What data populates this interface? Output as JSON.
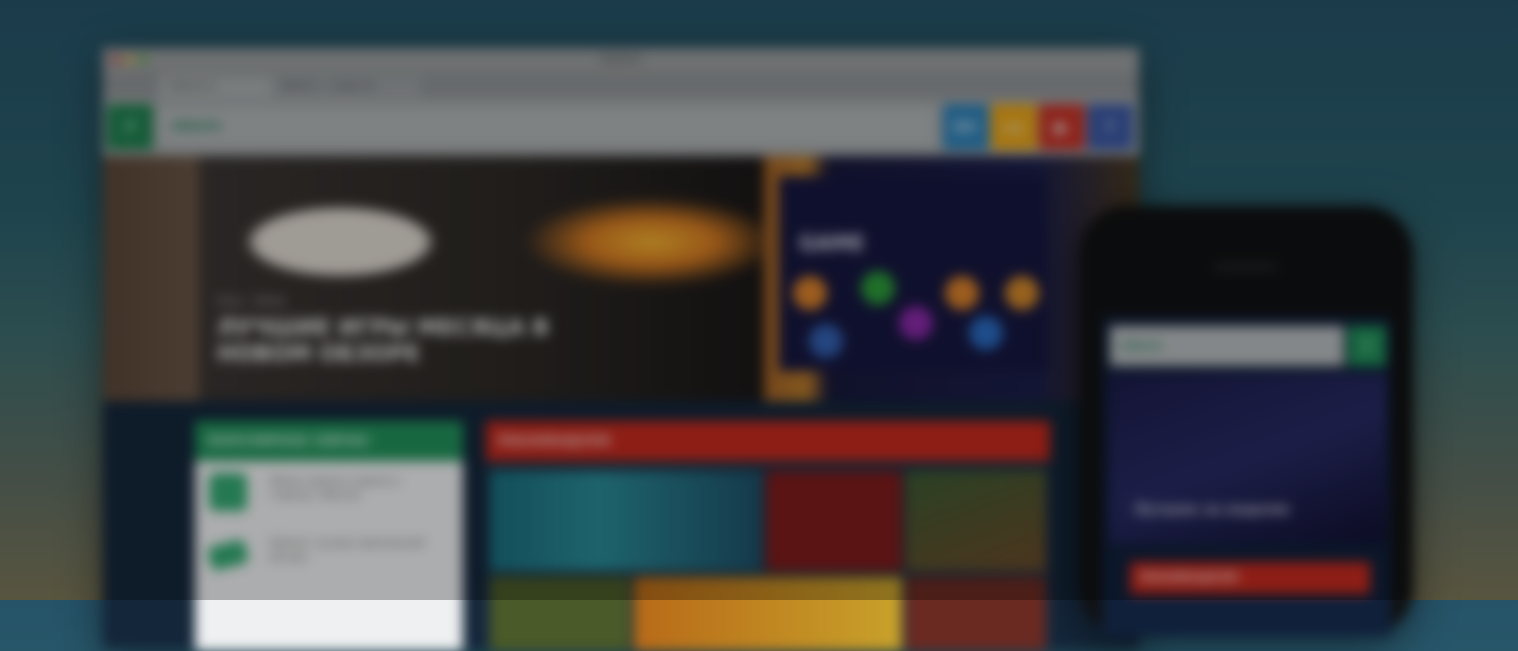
{
  "browser": {
    "window_title": "SIBERIO",
    "tabs": [
      "siberio.ru",
      "Siberio — новости"
    ],
    "search": {
      "brand": "siberio",
      "text": "siberio.ru"
    },
    "logo_glyph": "⚡",
    "social": [
      {
        "name": "vk",
        "glyph": "ВК",
        "color": "#2a7fb6"
      },
      {
        "name": "ok",
        "glyph": "ок",
        "color": "#e8a315"
      },
      {
        "name": "youtube",
        "glyph": "▶",
        "color": "#c43226"
      },
      {
        "name": "facebook",
        "glyph": "f",
        "color": "#3a57a2"
      }
    ],
    "hero": {
      "kicker": "Игры · Обзор",
      "headline": "Лучшие игры месяца в новом обзоре",
      "side_title": "GAME"
    },
    "trending": {
      "header": "ПОПУЛЯРНОЕ СЕЙЧАС",
      "items": [
        "Обзор новинок недели и главные события",
        "Рейтинг лучших приложений месяца"
      ]
    },
    "featured": {
      "header": "РЕКОМЕНДУЕМ"
    }
  },
  "phone": {
    "search": {
      "brand": "siberio",
      "text": "siberio.ru"
    },
    "logo_glyph": "⚡",
    "hero_title": "Лучшее за неделю",
    "featured_header": "РЕКОМЕНДУЕМ"
  },
  "colors": {
    "accent_green": "#22905a",
    "accent_red": "#c42a1e",
    "page_bg_top": "#265368"
  }
}
